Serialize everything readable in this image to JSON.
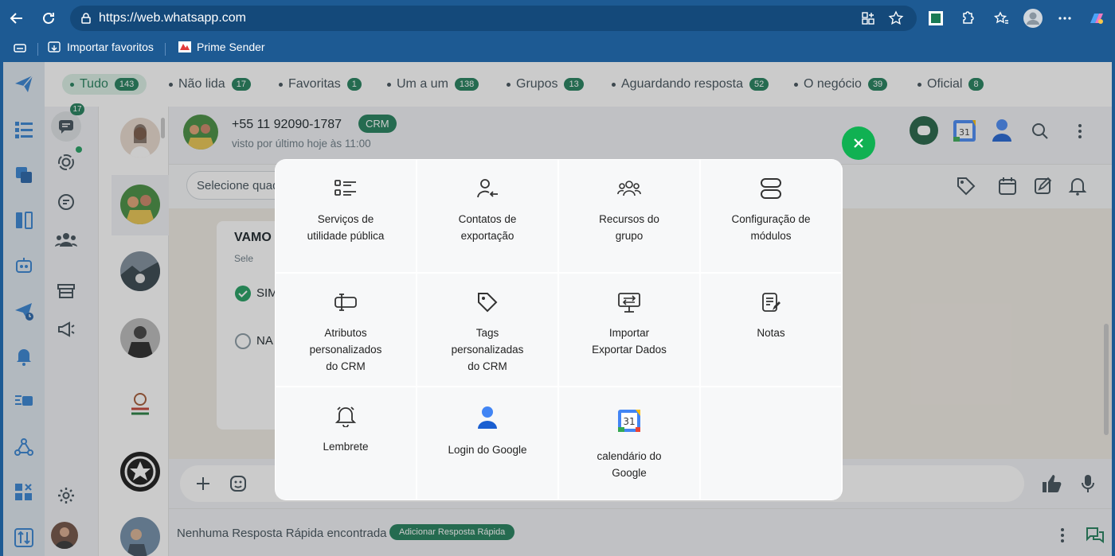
{
  "browser": {
    "url": "https://web.whatsapp.com",
    "favorites": [
      {
        "label": "Importar favoritos"
      },
      {
        "label": "Prime Sender"
      }
    ]
  },
  "filters": [
    {
      "label": "Tudo",
      "count": "143",
      "active": true
    },
    {
      "label": "Não lida",
      "count": "17"
    },
    {
      "label": "Favoritas",
      "count": "1"
    },
    {
      "label": "Um a um",
      "count": "138"
    },
    {
      "label": "Grupos",
      "count": "13"
    },
    {
      "label": "Aguardando resposta",
      "count": "52"
    },
    {
      "label": "O negócio",
      "count": "39"
    },
    {
      "label": "Oficial",
      "count": "8"
    }
  ],
  "sidebar": {
    "chats_badge": "17"
  },
  "chat": {
    "phone": "+55 11 92090-1787",
    "crm_label": "CRM",
    "status": "visto por último hoje às 11:00",
    "select_placeholder": "Selecione quad",
    "message_title": "VAMO",
    "message_sub": "Sele",
    "option_yes": "SIM",
    "option_no": "NA",
    "calendar_day": "31"
  },
  "quickreply": {
    "empty_text": "Nenhuma Resposta Rápida encontrada",
    "add_label": "Adicionar Resposta Rápida"
  },
  "modal": {
    "tiles": [
      {
        "label": "Serviços de utilidade pública",
        "icon": "list-icon"
      },
      {
        "label": "Contatos de exportação",
        "icon": "user-export-icon"
      },
      {
        "label": "Recursos do grupo",
        "icon": "group-icon"
      },
      {
        "label": "Configuração de módulos",
        "icon": "modules-icon"
      },
      {
        "label": "Atributos personalizados do CRM",
        "icon": "attributes-icon"
      },
      {
        "label": "Tags personalizadas do CRM",
        "icon": "tag-icon"
      },
      {
        "label": "Importar Exportar Dados",
        "icon": "import-export-icon"
      },
      {
        "label": "Notas",
        "icon": "notes-icon"
      },
      {
        "label": "Lembrete",
        "icon": "bell-icon"
      },
      {
        "label": "Login do Google",
        "icon": "google-user-icon"
      },
      {
        "label": "calendário do Google",
        "icon": "google-calendar-icon",
        "day": "31"
      }
    ]
  },
  "colors": {
    "accent": "#1a7a55",
    "browser": "#1d5a93",
    "fab": "#10b152"
  }
}
